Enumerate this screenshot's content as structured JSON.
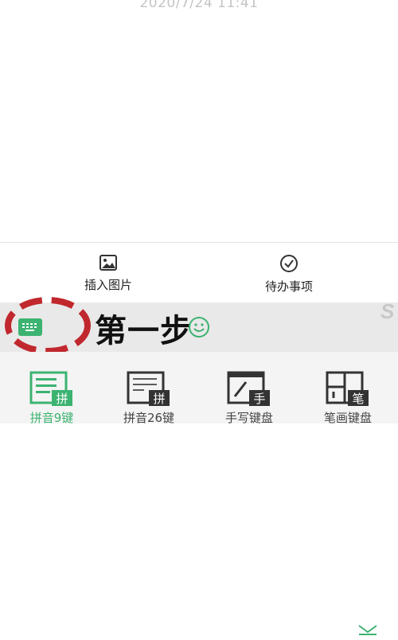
{
  "note": {
    "timestamp": "2020/7/24 11:41"
  },
  "actions": {
    "insert_image": {
      "label": "插入图片",
      "icon": "image-icon"
    },
    "todo": {
      "label": "待办事项",
      "icon": "check-circle-icon"
    }
  },
  "toolbar": {
    "keyboard_switch_icon": "keyboard-icon",
    "step_label": "第一步",
    "smiley_icon": "smiley-icon",
    "collapse_icon": "chevron-down-icon",
    "watermark": "S",
    "accent_color": "#3cb371",
    "annotation_color": "#c0282e"
  },
  "keyboard_layouts": [
    {
      "label": "拼音9键",
      "badge": "拼",
      "icon": "pinyin9-keyboard-icon",
      "active": true
    },
    {
      "label": "拼音26键",
      "badge": "拼",
      "icon": "pinyin26-keyboard-icon",
      "active": false
    },
    {
      "label": "手写键盘",
      "badge": "手",
      "icon": "handwriting-keyboard-icon",
      "active": false
    },
    {
      "label": "笔画键盘",
      "badge": "笔",
      "icon": "stroke-keyboard-icon",
      "active": false
    }
  ]
}
